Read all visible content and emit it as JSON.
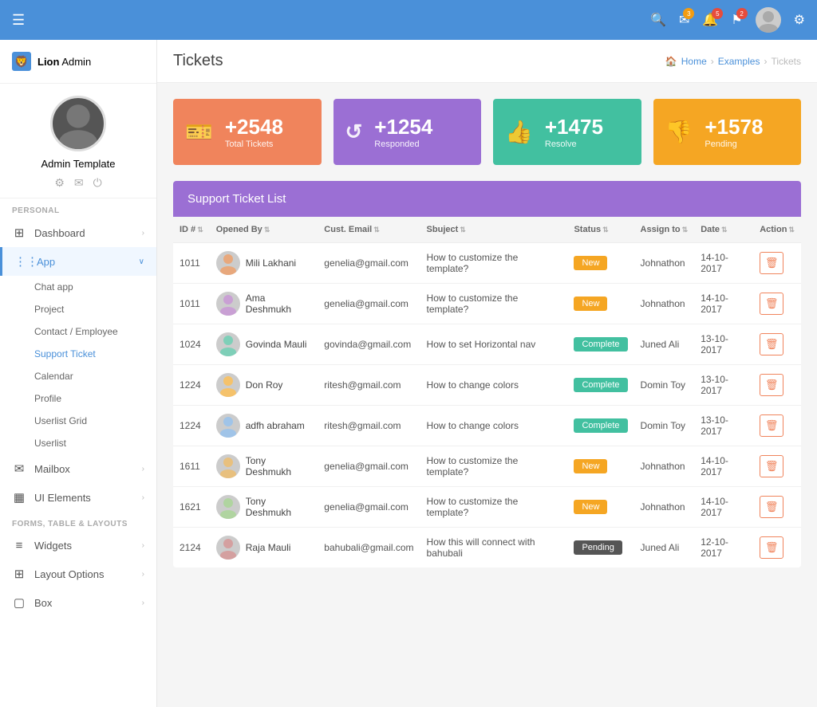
{
  "topnav": {
    "hamburger_label": "☰",
    "search_icon": "🔍",
    "mail_icon": "✉",
    "bell_icon": "🔔",
    "flag_icon": "⚑",
    "gear_icon": "⚙"
  },
  "sidebar": {
    "brand": {
      "lion": "Lion",
      "admin": " Admin"
    },
    "username": "Admin Template",
    "section_personal": "PERSONAL",
    "section_forms": "FORMS, TABLE & LAYOUTS",
    "items": [
      {
        "id": "dashboard",
        "label": "Dashboard",
        "icon": "grid",
        "has_arrow": true
      },
      {
        "id": "app",
        "label": "App",
        "icon": "apps",
        "has_arrow": true,
        "expanded": true
      }
    ],
    "subitems": [
      {
        "id": "chat-app",
        "label": "Chat app",
        "active": false
      },
      {
        "id": "project",
        "label": "Project",
        "active": false
      },
      {
        "id": "contact-employee",
        "label": "Contact / Employee",
        "active": false
      },
      {
        "id": "support-ticket",
        "label": "Support Ticket",
        "active": true
      },
      {
        "id": "calendar",
        "label": "Calendar",
        "active": false
      },
      {
        "id": "profile",
        "label": "Profile",
        "active": false
      },
      {
        "id": "userlist-grid",
        "label": "Userlist Grid",
        "active": false
      },
      {
        "id": "userlist",
        "label": "Userlist",
        "active": false
      }
    ],
    "items2": [
      {
        "id": "mailbox",
        "label": "Mailbox",
        "icon": "mail",
        "has_arrow": true
      },
      {
        "id": "ui-elements",
        "label": "UI Elements",
        "icon": "ui",
        "has_arrow": true
      }
    ],
    "items3": [
      {
        "id": "widgets",
        "label": "Widgets",
        "icon": "widgets",
        "has_arrow": true
      },
      {
        "id": "layout-options",
        "label": "Layout Options",
        "icon": "layout",
        "has_arrow": true
      },
      {
        "id": "box",
        "label": "Box",
        "icon": "box",
        "has_arrow": true
      }
    ]
  },
  "page": {
    "title": "Tickets",
    "breadcrumb": {
      "home": "Home",
      "examples": "Examples",
      "current": "Tickets"
    }
  },
  "stats": [
    {
      "id": "total",
      "number": "+2548",
      "label": "Total Tickets",
      "color": "stat-orange",
      "icon": "🎫"
    },
    {
      "id": "responded",
      "number": "+1254",
      "label": "Responded",
      "color": "stat-purple",
      "icon": "↺"
    },
    {
      "id": "resolve",
      "number": "+1475",
      "label": "Resolve",
      "color": "stat-green",
      "icon": "👍"
    },
    {
      "id": "pending",
      "number": "+1578",
      "label": "Pending",
      "color": "stat-yellow",
      "icon": "👎"
    }
  ],
  "ticket_table": {
    "title": "Support Ticket List",
    "columns": [
      "ID #",
      "Opened By",
      "Cust. Email",
      "Sbuject",
      "Status",
      "Assign to",
      "Date",
      "Action"
    ],
    "rows": [
      {
        "id": "1011",
        "name": "Mili Lakhani",
        "email": "genelia@gmail.com",
        "subject": "How to customize the template?",
        "status": "New",
        "assign": "Johnathon",
        "date": "14-10-2017"
      },
      {
        "id": "1011",
        "name": "Ama Deshmukh",
        "email": "genelia@gmail.com",
        "subject": "How to customize the template?",
        "status": "New",
        "assign": "Johnathon",
        "date": "14-10-2017"
      },
      {
        "id": "1024",
        "name": "Govinda Mauli",
        "email": "govinda@gmail.com",
        "subject": "How to set Horizontal nav",
        "status": "Complete",
        "assign": "Juned Ali",
        "date": "13-10-2017"
      },
      {
        "id": "1224",
        "name": "Don Roy",
        "email": "ritesh@gmail.com",
        "subject": "How to change colors",
        "status": "Complete",
        "assign": "Domin Toy",
        "date": "13-10-2017"
      },
      {
        "id": "1224",
        "name": "adfh abraham",
        "email": "ritesh@gmail.com",
        "subject": "How to change colors",
        "status": "Complete",
        "assign": "Domin Toy",
        "date": "13-10-2017"
      },
      {
        "id": "1611",
        "name": "Tony Deshmukh",
        "email": "genelia@gmail.com",
        "subject": "How to customize the template?",
        "status": "New",
        "assign": "Johnathon",
        "date": "14-10-2017"
      },
      {
        "id": "1621",
        "name": "Tony Deshmukh",
        "email": "genelia@gmail.com",
        "subject": "How to customize the template?",
        "status": "New",
        "assign": "Johnathon",
        "date": "14-10-2017"
      },
      {
        "id": "2124",
        "name": "Raja Mauli",
        "email": "bahubali@gmail.com",
        "subject": "How this will connect with bahubali",
        "status": "Pending",
        "assign": "Juned Ali",
        "date": "12-10-2017"
      }
    ]
  }
}
